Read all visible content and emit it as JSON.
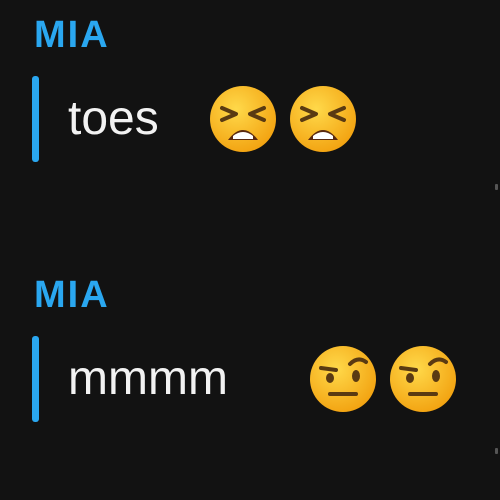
{
  "messages": [
    {
      "sender": "MIA",
      "text": "toes",
      "emojis": [
        "tired-face-emoji",
        "tired-face-emoji"
      ]
    },
    {
      "sender": "MIA",
      "text": "mmmm",
      "emojis": [
        "face-with-raised-eyebrow-emoji",
        "face-with-raised-eyebrow-emoji"
      ]
    }
  ],
  "colors": {
    "background": "#121212",
    "accent": "#2aa7f0",
    "text": "#f2f2f2",
    "emoji_yellow": "#f6b21a"
  }
}
